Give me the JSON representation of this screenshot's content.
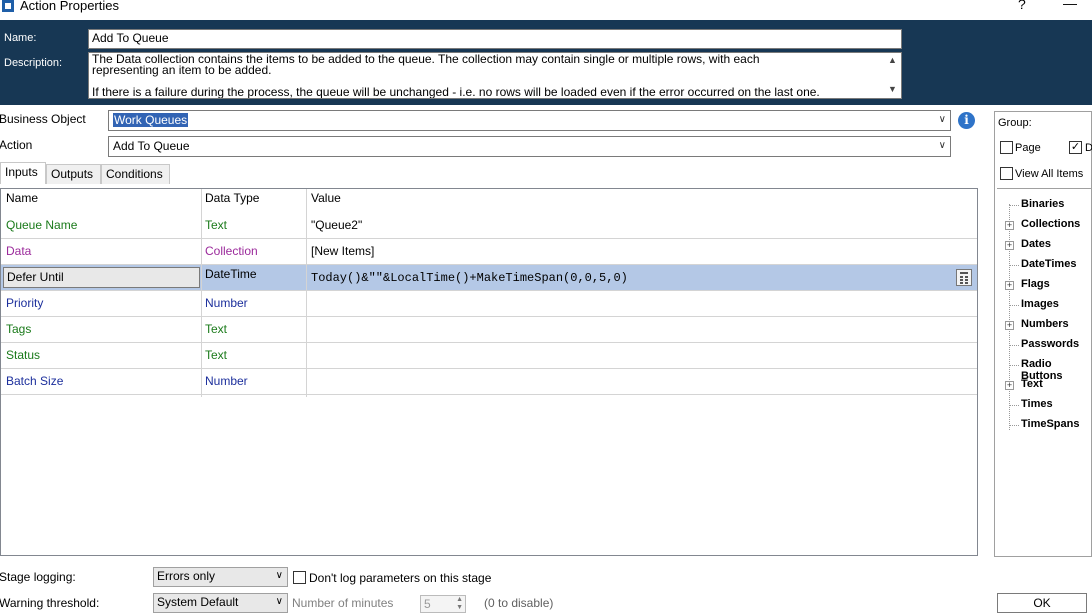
{
  "window": {
    "title": "Action Properties",
    "help_label": "?",
    "minimize_label": "—"
  },
  "header": {
    "name_label": "Name:",
    "name_value": "Add To Queue",
    "description_label": "Description:",
    "description_value": "The Data collection contains the items to be added to the queue. The collection may contain single or multiple rows, with each\nrepresenting an item to be added.\n\nIf there is a failure during the process, the queue will be unchanged - i.e. no rows will be loaded even if the error occurred on the last one."
  },
  "business_object": {
    "label": "Business Object",
    "value": "Work Queues"
  },
  "action": {
    "label": "Action",
    "value": "Add To Queue"
  },
  "tabs": [
    {
      "label": "Inputs",
      "active": true
    },
    {
      "label": "Outputs",
      "active": false
    },
    {
      "label": "Conditions",
      "active": false
    }
  ],
  "grid": {
    "columns": [
      "Name",
      "Data Type",
      "Value"
    ],
    "rows": [
      {
        "name": "Queue Name",
        "type": "Text",
        "value": "\"Queue2\"",
        "color": "#1a7a1a"
      },
      {
        "name": "Data",
        "type": "Collection",
        "value": "[New Items]",
        "color": "#9b2a9b"
      },
      {
        "name": "Defer Until",
        "type": "DateTime",
        "value": "Today()&\"\"&LocalTime()+MakeTimeSpan(0,0,5,0)",
        "color": "#000000"
      },
      {
        "name": "Priority",
        "type": "Number",
        "value": "",
        "color": "#1c2f9c"
      },
      {
        "name": "Tags",
        "type": "Text",
        "value": "",
        "color": "#1a7a1a"
      },
      {
        "name": "Status",
        "type": "Text",
        "value": "",
        "color": "#1a7a1a"
      },
      {
        "name": "Batch Size",
        "type": "Number",
        "value": "",
        "color": "#1c2f9c"
      }
    ]
  },
  "sidebar": {
    "group_label": "Group:",
    "page_label": "Page",
    "page_checked": false,
    "d_label": "D",
    "d_checked": true,
    "view_all_label": "View All Items",
    "view_all_checked": false,
    "tree": [
      {
        "label": "Binaries",
        "expandable": false
      },
      {
        "label": "Collections",
        "expandable": true
      },
      {
        "label": "Dates",
        "expandable": true
      },
      {
        "label": "DateTimes",
        "expandable": false
      },
      {
        "label": "Flags",
        "expandable": true
      },
      {
        "label": "Images",
        "expandable": false
      },
      {
        "label": "Numbers",
        "expandable": true
      },
      {
        "label": "Passwords",
        "expandable": false
      },
      {
        "label": "Radio Buttons",
        "expandable": false
      },
      {
        "label": "Text",
        "expandable": true
      },
      {
        "label": "Times",
        "expandable": false
      },
      {
        "label": "TimeSpans",
        "expandable": false
      }
    ]
  },
  "footer": {
    "stage_logging_label": "Stage logging:",
    "stage_logging_value": "Errors only",
    "dont_log_label": "Don't log parameters on this stage",
    "warning_label": "Warning threshold:",
    "warning_value": "System Default",
    "minutes_label": "Number of minutes",
    "minutes_value": "5",
    "disable_hint": "(0 to disable)",
    "ok_label": "OK"
  }
}
